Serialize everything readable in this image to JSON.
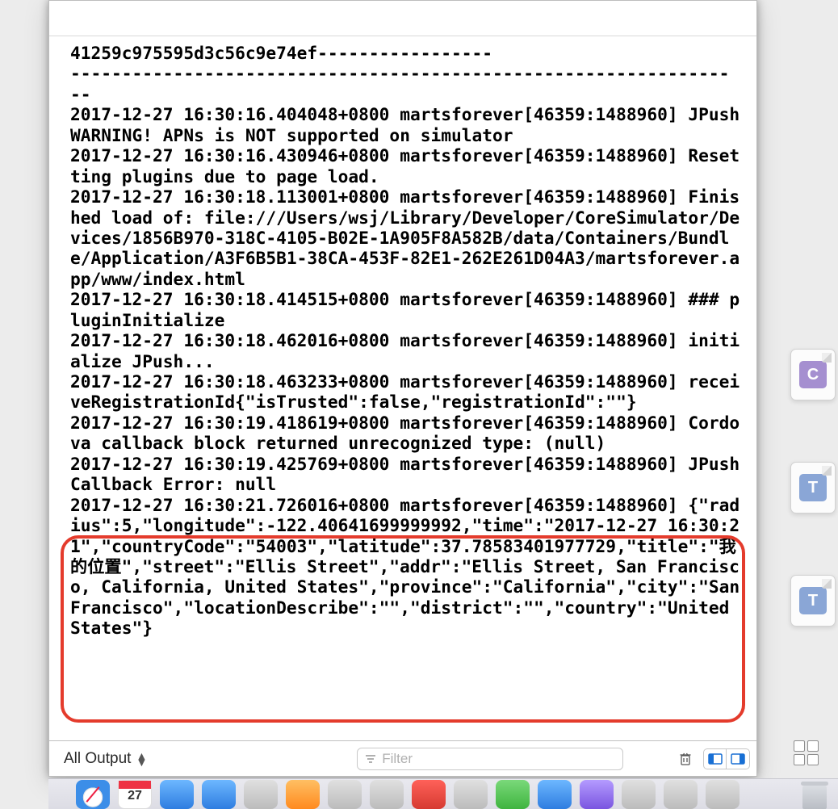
{
  "console": {
    "lines": "41259c975595d3c56c9e74ef-----------------\n----------------------------------------------------------------\n--\n2017-12-27 16:30:16.404048+0800 martsforever[46359:1488960] JPush WARNING! APNs is NOT supported on simulator\n2017-12-27 16:30:16.430946+0800 martsforever[46359:1488960] Resetting plugins due to page load.\n2017-12-27 16:30:18.113001+0800 martsforever[46359:1488960] Finished load of: file:///Users/wsj/Library/Developer/CoreSimulator/Devices/1856B970-318C-4105-B02E-1A905F8A582B/data/Containers/Bundle/Application/A3F6B5B1-38CA-453F-82E1-262E261D04A3/martsforever.app/www/index.html\n2017-12-27 16:30:18.414515+0800 martsforever[46359:1488960] ### pluginInitialize\n2017-12-27 16:30:18.462016+0800 martsforever[46359:1488960] initialize JPush...\n2017-12-27 16:30:18.463233+0800 martsforever[46359:1488960] receiveRegistrationId{\"isTrusted\":false,\"registrationId\":\"\"}\n2017-12-27 16:30:19.418619+0800 martsforever[46359:1488960] Cordova callback block returned unrecognized type: (null)\n2017-12-27 16:30:19.425769+0800 martsforever[46359:1488960] JPush Callback Error: null\n2017-12-27 16:30:21.726016+0800 martsforever[46359:1488960] {\"radius\":5,\"longitude\":-122.40641699999992,\"time\":\"2017-12-27 16:30:21\",\"countryCode\":\"54003\",\"latitude\":37.78583401977729,\"title\":\"我的位置\",\"street\":\"Ellis Street\",\"addr\":\"Ellis Street, San Francisco, California, United States\",\"province\":\"California\",\"city\":\"San Francisco\",\"locationDescribe\":\"\",\"district\":\"\",\"country\":\"United States\"}"
  },
  "toolbar": {
    "output_selector": "All Output",
    "filter_placeholder": "Filter"
  },
  "dock": {
    "glyphs": {
      "c": "C",
      "t1": "T",
      "t2": "T"
    }
  }
}
